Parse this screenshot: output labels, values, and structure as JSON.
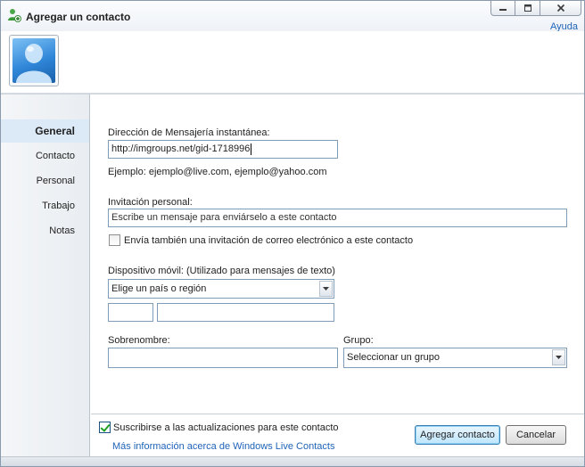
{
  "window": {
    "title": "Agregar un contacto",
    "help_label": "Ayuda"
  },
  "sidebar": {
    "items": [
      {
        "label": "General",
        "active": true
      },
      {
        "label": "Contacto",
        "active": false
      },
      {
        "label": "Personal",
        "active": false
      },
      {
        "label": "Trabajo",
        "active": false
      },
      {
        "label": "Notas",
        "active": false
      }
    ]
  },
  "form": {
    "im_address": {
      "label": "Dirección de Mensajería instantánea:",
      "value": "http://imgroups.net/gid-1718996",
      "example": "Ejemplo: ejemplo@live.com, ejemplo@yahoo.com"
    },
    "invitation": {
      "label": "Invitación personal:",
      "value": "Escribe un mensaje para enviárselo a este contacto",
      "email_invite_label": "Envía también una invitación de correo electrónico a este contacto",
      "email_invite_checked": false
    },
    "mobile": {
      "label": "Dispositivo móvil: (Utilizado para mensajes de texto)",
      "country_selected": "Elige un país o región",
      "code_value": "",
      "number_value": ""
    },
    "nickname": {
      "label": "Sobrenombre:",
      "value": ""
    },
    "group": {
      "label": "Grupo:",
      "selected": "Seleccionar un grupo"
    }
  },
  "footer": {
    "subscribe_label": "Suscribirse a las actualizaciones para este contacto",
    "subscribe_checked": true,
    "more_info_link": "Más información acerca de Windows Live Contacts",
    "add_button": "Agregar contacto",
    "cancel_button": "Cancelar"
  },
  "colors": {
    "link": "#1f63b8",
    "active_nav": "#dce9f6",
    "border": "#7f9db9"
  }
}
